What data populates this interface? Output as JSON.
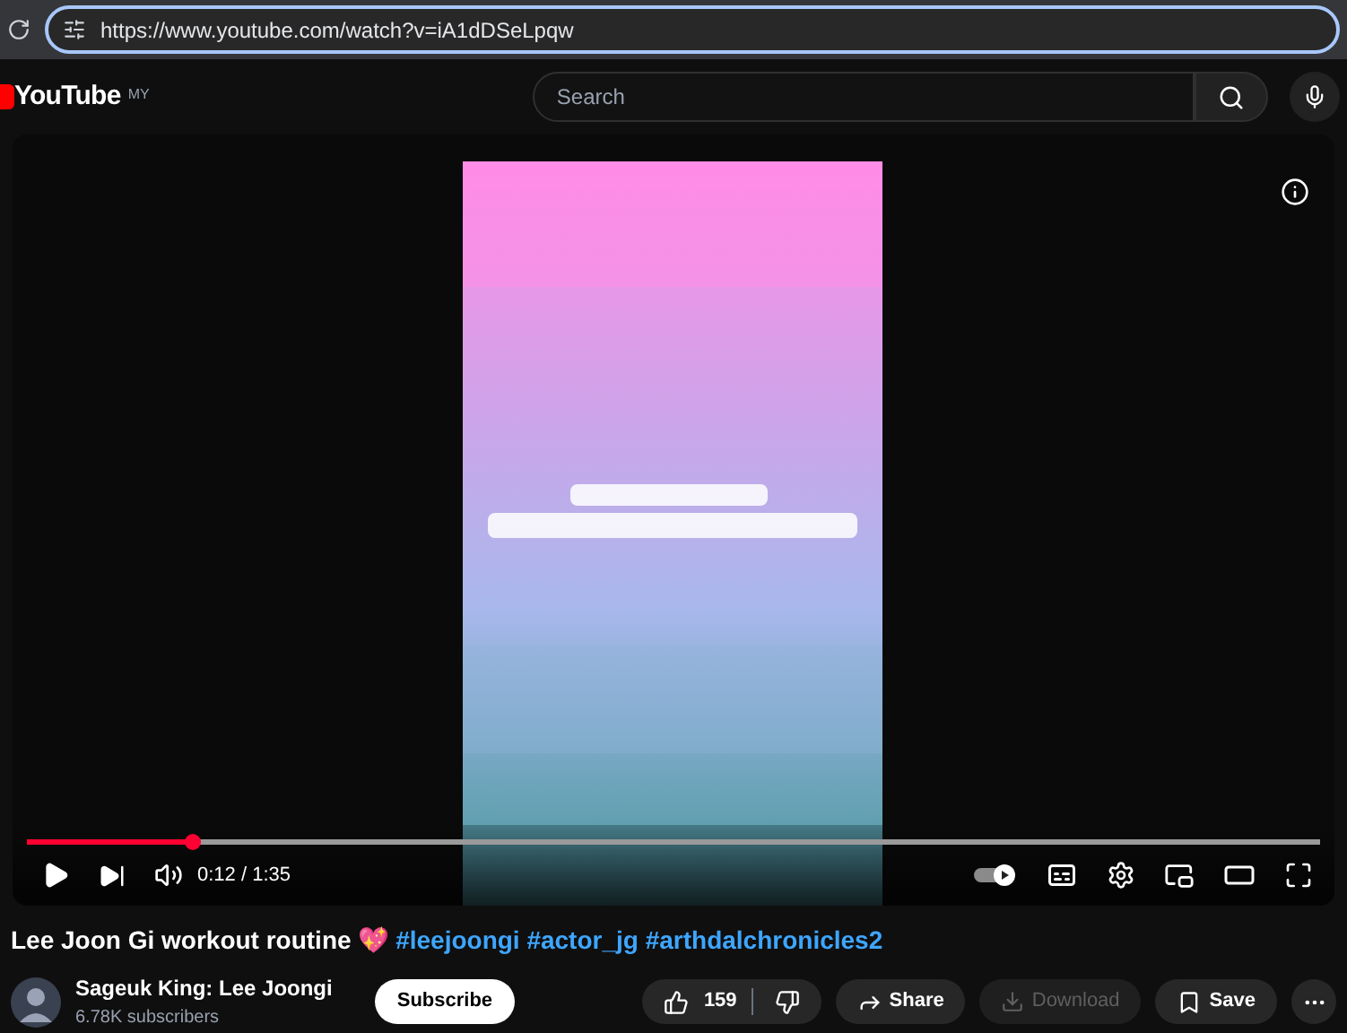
{
  "browser": {
    "url": "https://www.youtube.com/watch?v=iA1dDSeLpqw"
  },
  "header": {
    "logo": "YouTube",
    "region": "MY",
    "search": {
      "placeholder": "Search"
    }
  },
  "player": {
    "progress": {
      "level": 0.128
    },
    "time": "0:12 / 1:35"
  },
  "video": {
    "title": "Lee Joon Gi workout routine 💖",
    "hashtags": [
      "#leejoongi",
      "#actor_jg",
      "#arthdalchronicles2"
    ]
  },
  "channel": {
    "name": "Sageuk King: Lee Joongi",
    "subscribers": "6.78K subscribers",
    "subscribe": "Subscribe"
  },
  "actions": {
    "likes": "159",
    "share": "Share",
    "download": {
      "label": "Download",
      "disabled": true
    },
    "save": "Save"
  }
}
